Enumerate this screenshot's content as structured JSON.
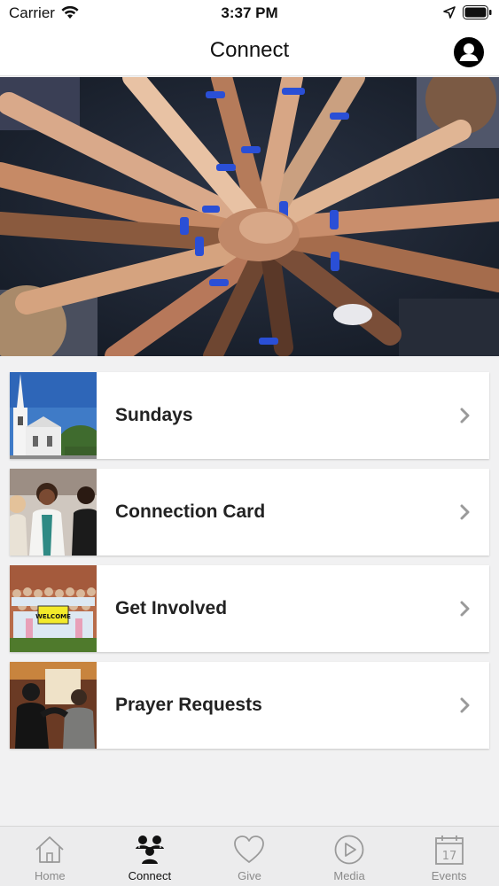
{
  "status_bar": {
    "carrier": "Carrier",
    "time": "3:37 PM"
  },
  "header": {
    "title": "Connect",
    "profile_icon": "user-circle-icon"
  },
  "hero": {
    "image": "hands-together-photo"
  },
  "cards": [
    {
      "label": "Sundays",
      "thumb": "church-building-photo"
    },
    {
      "label": "Connection Card",
      "thumb": "people-talking-photo"
    },
    {
      "label": "Get Involved",
      "thumb": "group-welcome-sign-photo"
    },
    {
      "label": "Prayer Requests",
      "thumb": "people-praying-photo"
    }
  ],
  "tab_bar": {
    "active": "Connect",
    "tabs": [
      {
        "label": "Home",
        "icon": "home-icon"
      },
      {
        "label": "Connect",
        "icon": "people-icon"
      },
      {
        "label": "Give",
        "icon": "heart-icon"
      },
      {
        "label": "Media",
        "icon": "play-circle-icon"
      },
      {
        "label": "Events",
        "icon": "calendar-icon"
      }
    ]
  },
  "colors": {
    "background": "#f1f1f2",
    "card": "#ffffff",
    "text": "#222222",
    "tab_inactive": "#8a8a8a",
    "tab_active": "#111111"
  }
}
